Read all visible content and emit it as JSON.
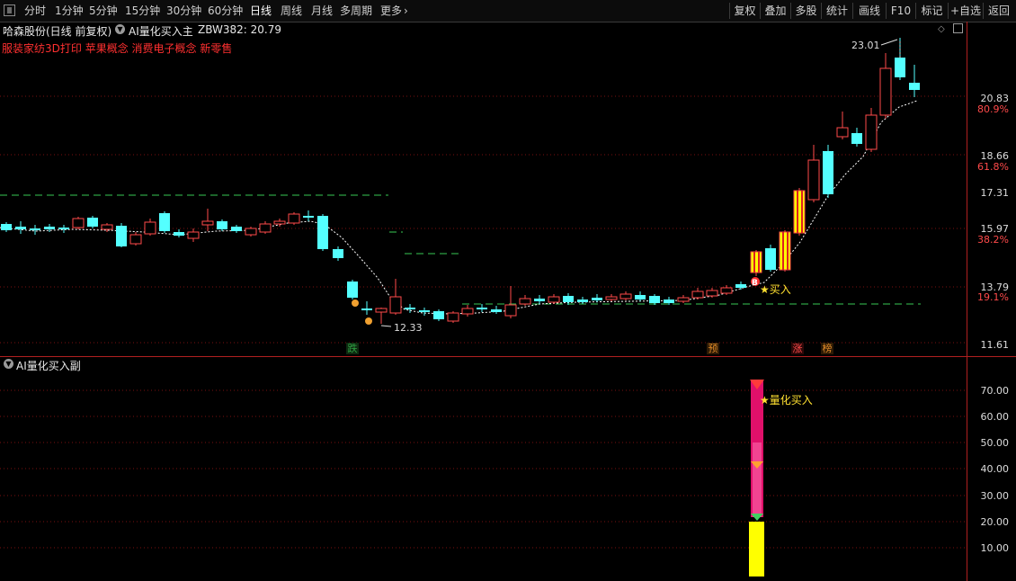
{
  "toolbar": {
    "periods": [
      "分时",
      "1分钟",
      "5分钟",
      "15分钟",
      "30分钟",
      "60分钟",
      "日线",
      "周线",
      "月线",
      "多周期",
      "更多"
    ],
    "active_period": "日线",
    "more_arrow": "›",
    "right_buttons": [
      "复权",
      "叠加",
      "多股",
      "统计",
      "画线",
      "F10",
      "标记",
      "+自选",
      "返回"
    ]
  },
  "main_chart": {
    "stock_title": "哈森股份(日线 前复权)",
    "indicator_name": "AI量化买入主",
    "indicator_value": "ZBW382: 20.79",
    "concepts": "服装家纺3D打印 苹果概念 消费电子概念 新零售",
    "high_label": "23.01",
    "low_label": "12.33",
    "buy_label": "★买入",
    "b_marker": "B",
    "y_labels": [
      "20.83",
      "18.66",
      "17.31",
      "15.97",
      "13.79",
      "11.61"
    ],
    "pct_labels": [
      "80.9%",
      "61.8%",
      "38.2%",
      "19.1%"
    ],
    "badges": [
      {
        "text": "跌",
        "color": "#2ea043",
        "bg": "#0e2a10"
      },
      {
        "text": "预",
        "color": "#e08a28",
        "bg": "#2d1a05"
      },
      {
        "text": "涨",
        "color": "#ff4a4a",
        "bg": "#2d0808"
      },
      {
        "text": "榜",
        "color": "#e08a28",
        "bg": "#2d1a05"
      }
    ]
  },
  "sub_chart": {
    "name": "AI量化买入副",
    "signal_label": "★量化买入",
    "y_labels": [
      "70.00",
      "60.00",
      "50.00",
      "40.00",
      "30.00",
      "20.00",
      "10.00"
    ]
  },
  "colors": {
    "up": "#ff4a4a",
    "down": "#54ffff",
    "ma": "#ffffff",
    "green_dash": "#2ea043",
    "yellow": "#ffff00",
    "red_grid": "#7a1010",
    "separator": "#b02020"
  }
}
